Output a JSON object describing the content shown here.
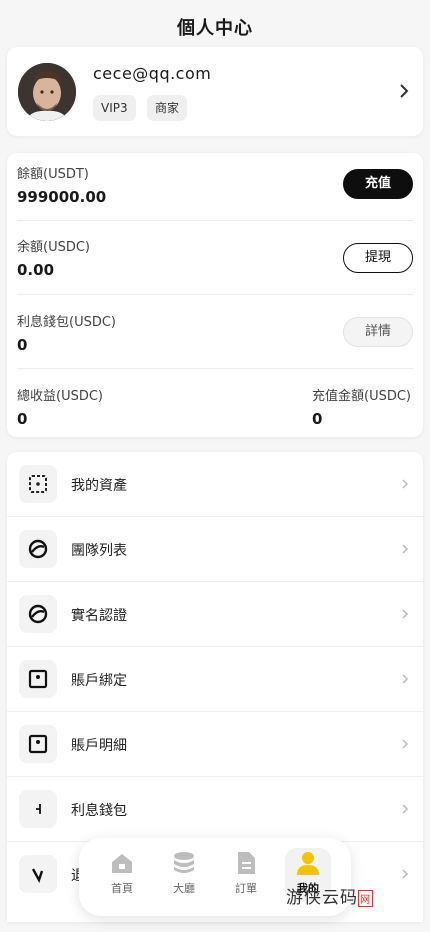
{
  "header": {
    "title": "個人中心"
  },
  "profile": {
    "email": "cece@qq.com",
    "badges": [
      "VIP3",
      "商家"
    ]
  },
  "balances": {
    "usdt": {
      "label": "餘額(USDT)",
      "value": "999000.00",
      "action": "充值"
    },
    "usdc": {
      "label": "余額(USDC)",
      "value": "0.00",
      "action": "提現"
    },
    "interest": {
      "label": "利息錢包(USDC)",
      "value": "0",
      "action": "詳情"
    },
    "total_income": {
      "label": "總收益(USDC)",
      "value": "0"
    },
    "recharge_total": {
      "label": "充值金額(USDC)",
      "value": "0"
    }
  },
  "menu": {
    "items": [
      {
        "label": "我的資產",
        "icon": "wallet-icon"
      },
      {
        "label": "團隊列表",
        "icon": "team-icon"
      },
      {
        "label": "實名認證",
        "icon": "verify-icon"
      },
      {
        "label": "賬戶綁定",
        "icon": "bind-icon"
      },
      {
        "label": "賬戶明細",
        "icon": "details-icon"
      },
      {
        "label": "利息錢包",
        "icon": "interest-icon"
      },
      {
        "label": "退",
        "icon": "logout-icon"
      }
    ]
  },
  "tabbar": {
    "tabs": [
      {
        "label": "首頁",
        "icon": "home-icon"
      },
      {
        "label": "大廳",
        "icon": "coins-icon"
      },
      {
        "label": "訂單",
        "icon": "document-icon"
      },
      {
        "label": "我的",
        "icon": "user-icon"
      }
    ],
    "active_color": "#f5c400",
    "inactive_color": "#bdbdbd"
  },
  "watermark": {
    "text": "游侠云码",
    "badge": "网"
  }
}
